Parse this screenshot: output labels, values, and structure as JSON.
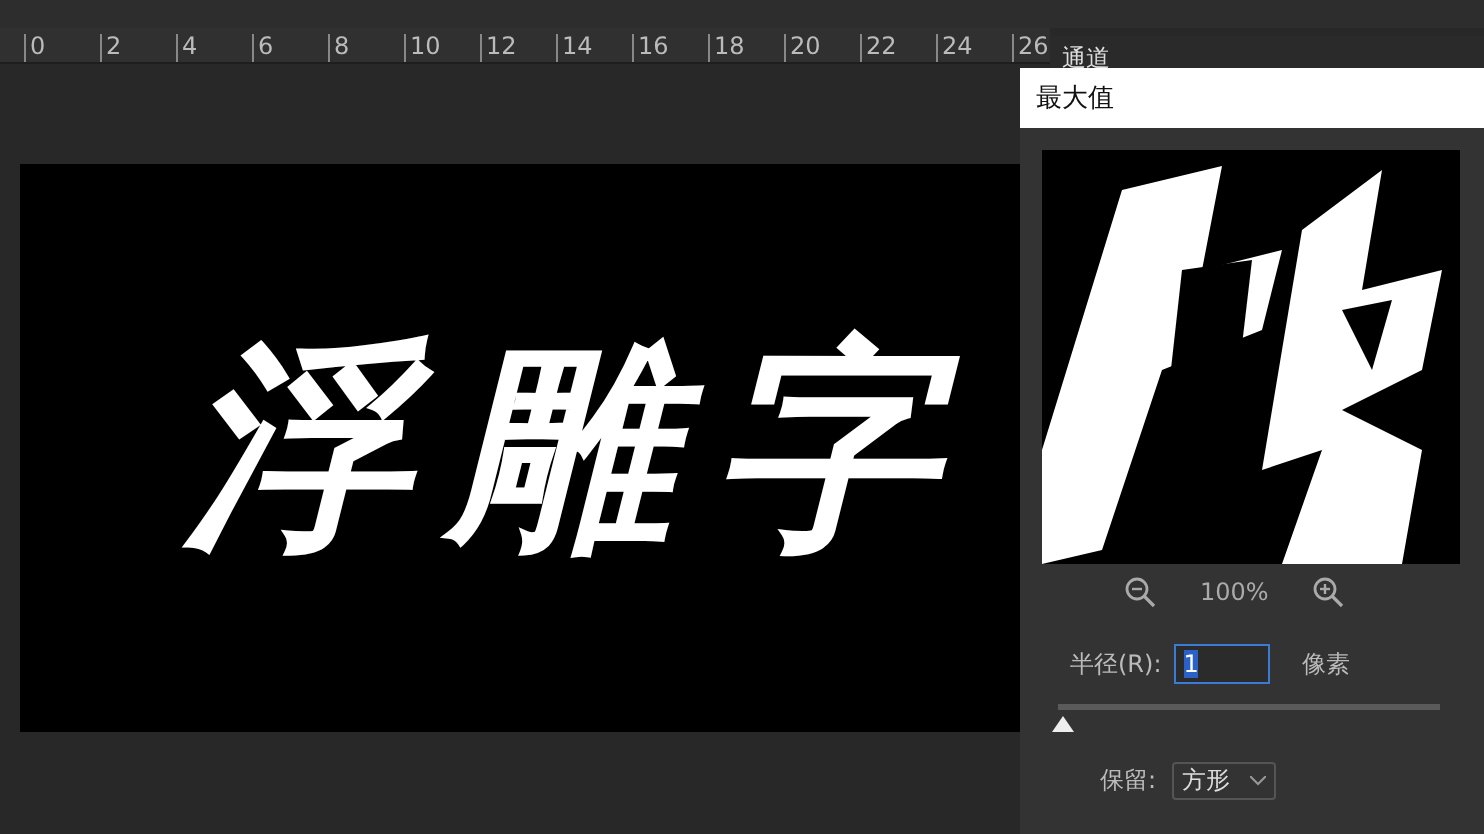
{
  "ruler": {
    "ticks": [
      "0",
      "2",
      "4",
      "6",
      "8",
      "10",
      "12",
      "14",
      "16",
      "18",
      "20",
      "22",
      "24",
      "26"
    ]
  },
  "canvas": {
    "text": "浮雕字"
  },
  "panel": {
    "tab": "通道"
  },
  "dialog": {
    "title": "最大值",
    "zoom": "100%",
    "radius": {
      "label": "半径(R):",
      "value": "1",
      "unit": "像素"
    },
    "slider": {
      "level": 0
    },
    "keep": {
      "label": "保留:",
      "value": "方形"
    }
  }
}
